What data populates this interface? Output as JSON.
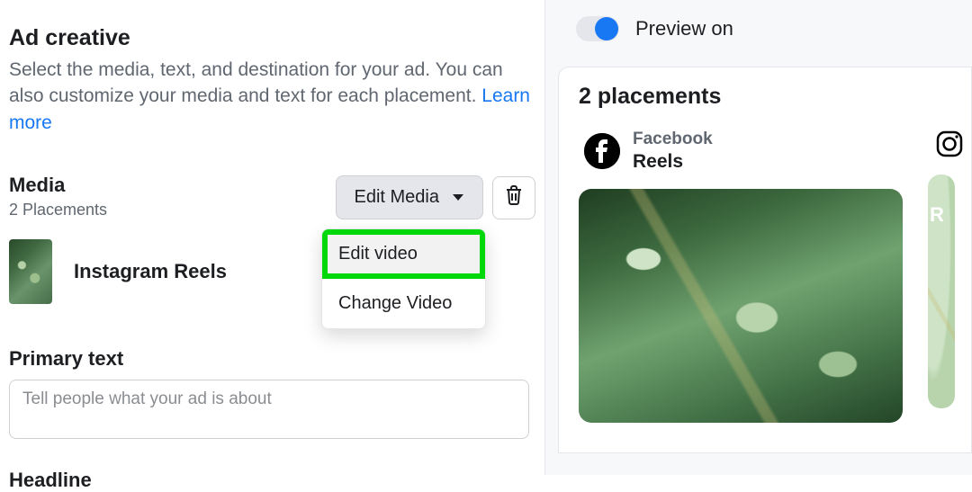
{
  "ad_creative": {
    "title": "Ad creative",
    "description": "Select the media, text, and destination for your ad. You can also customize your media and text for each placement. ",
    "learn_more": "Learn more"
  },
  "media": {
    "label": "Media",
    "count_text": "2 Placements",
    "edit_button": "Edit Media",
    "placement_name": "Instagram Reels"
  },
  "media_menu": {
    "edit_video": "Edit video",
    "change_video": "Change Video"
  },
  "primary_text": {
    "label": "Primary text",
    "placeholder": "Tell people what your ad is about"
  },
  "headline": {
    "label": "Headline"
  },
  "preview": {
    "toggle_label": "Preview on",
    "placements_title": "2 placements",
    "cards": [
      {
        "platform": "Facebook",
        "format": "Reels"
      },
      {
        "platform": "Instagram",
        "format": "R"
      }
    ]
  }
}
